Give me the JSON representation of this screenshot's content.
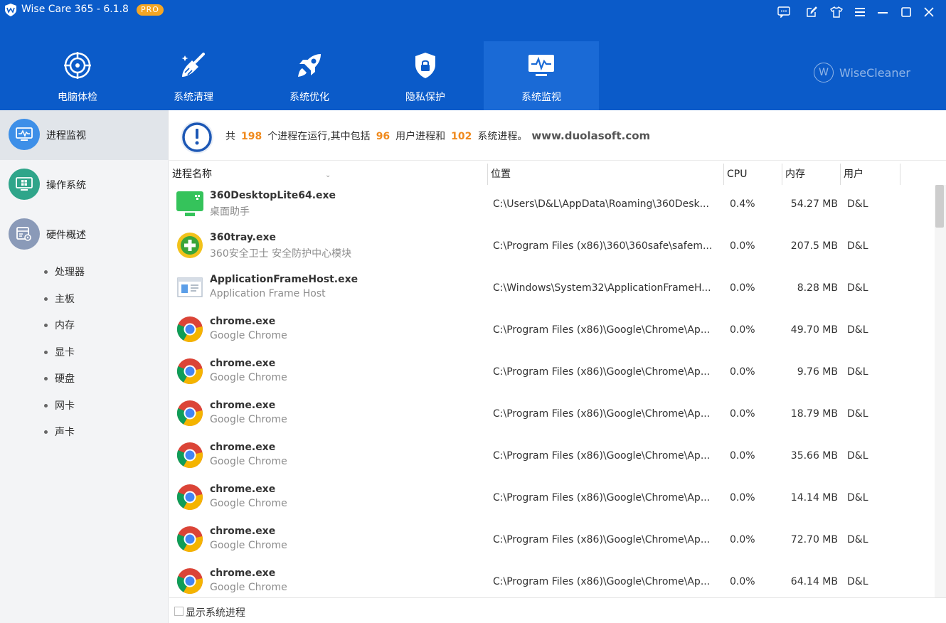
{
  "window": {
    "title": "Wise Care 365 - 6.1.8",
    "badge": "PRO"
  },
  "nav": {
    "tabs": [
      {
        "label": "电脑体检",
        "icon": "target-icon"
      },
      {
        "label": "系统清理",
        "icon": "broom-icon"
      },
      {
        "label": "系统优化",
        "icon": "rocket-icon"
      },
      {
        "label": "隐私保护",
        "icon": "shield-lock-icon"
      },
      {
        "label": "系统监视",
        "icon": "monitor-pulse-icon"
      }
    ],
    "active": "系统监视",
    "brand": "WiseCleaner",
    "brand_mark": "W"
  },
  "sidebar": {
    "items": [
      {
        "label": "进程监视",
        "icon": "process-monitor-icon"
      },
      {
        "label": "操作系统",
        "icon": "windows-os-icon"
      },
      {
        "label": "硬件概述",
        "icon": "hardware-icon"
      }
    ],
    "subitems": [
      "处理器",
      "主板",
      "内存",
      "显卡",
      "硬盘",
      "网卡",
      "声卡"
    ]
  },
  "summary": {
    "prefix": "共",
    "total": "198",
    "mid1": "个进程在运行,其中包括",
    "user_count": "96",
    "mid2": "用户进程和",
    "system_count": "102",
    "suffix": "系统进程。",
    "url": "www.duolasoft.com"
  },
  "table": {
    "columns": [
      "进程名称",
      "位置",
      "CPU",
      "内存",
      "用户"
    ],
    "rows": [
      {
        "name": "360DesktopLite64.exe",
        "desc": "桌面助手",
        "path": "C:\\Users\\D&L\\AppData\\Roaming\\360Desk...",
        "cpu": "0.4%",
        "mem": "54.27 MB",
        "user": "D&L",
        "icon": "green-monitor-icon"
      },
      {
        "name": "360tray.exe",
        "desc": "360安全卫士 安全防护中心模块",
        "path": "C:\\Program Files (x86)\\360\\360safe\\safem...",
        "cpu": "0.0%",
        "mem": "207.5 MB",
        "user": "D&L",
        "icon": "360-plus-icon"
      },
      {
        "name": "ApplicationFrameHost.exe",
        "desc": "Application Frame Host",
        "path": "C:\\Windows\\System32\\ApplicationFrameH...",
        "cpu": "0.0%",
        "mem": "8.28 MB",
        "user": "D&L",
        "icon": "app-window-icon"
      },
      {
        "name": "chrome.exe",
        "desc": "Google Chrome",
        "path": "C:\\Program Files (x86)\\Google\\Chrome\\Ap...",
        "cpu": "0.0%",
        "mem": "49.70 MB",
        "user": "D&L",
        "icon": "chrome-icon"
      },
      {
        "name": "chrome.exe",
        "desc": "Google Chrome",
        "path": "C:\\Program Files (x86)\\Google\\Chrome\\Ap...",
        "cpu": "0.0%",
        "mem": "9.76 MB",
        "user": "D&L",
        "icon": "chrome-icon"
      },
      {
        "name": "chrome.exe",
        "desc": "Google Chrome",
        "path": "C:\\Program Files (x86)\\Google\\Chrome\\Ap...",
        "cpu": "0.0%",
        "mem": "18.79 MB",
        "user": "D&L",
        "icon": "chrome-icon"
      },
      {
        "name": "chrome.exe",
        "desc": "Google Chrome",
        "path": "C:\\Program Files (x86)\\Google\\Chrome\\Ap...",
        "cpu": "0.0%",
        "mem": "35.66 MB",
        "user": "D&L",
        "icon": "chrome-icon"
      },
      {
        "name": "chrome.exe",
        "desc": "Google Chrome",
        "path": "C:\\Program Files (x86)\\Google\\Chrome\\Ap...",
        "cpu": "0.0%",
        "mem": "14.14 MB",
        "user": "D&L",
        "icon": "chrome-icon"
      },
      {
        "name": "chrome.exe",
        "desc": "Google Chrome",
        "path": "C:\\Program Files (x86)\\Google\\Chrome\\Ap...",
        "cpu": "0.0%",
        "mem": "72.70 MB",
        "user": "D&L",
        "icon": "chrome-icon"
      },
      {
        "name": "chrome.exe",
        "desc": "Google Chrome",
        "path": "C:\\Program Files (x86)\\Google\\Chrome\\Ap...",
        "cpu": "0.0%",
        "mem": "64.14 MB",
        "user": "D&L",
        "icon": "chrome-icon"
      }
    ]
  },
  "footer": {
    "show_system_label": "显示系统进程",
    "show_system_checked": false
  },
  "colors": {
    "header_blue": "#0b5bc9",
    "active_tab": "#1a6ad6",
    "accent_orange": "#f08a1d",
    "pro_badge": "#f5a623"
  }
}
